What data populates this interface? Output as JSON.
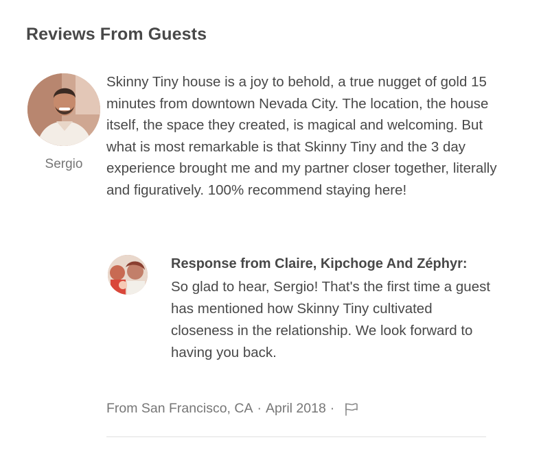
{
  "section": {
    "title": "Reviews From Guests"
  },
  "review": {
    "reviewer_name": "Sergio",
    "avatar_icon": "guest-avatar-photo",
    "text": "Skinny Tiny house is a joy to behold, a true nugget of gold 15 minutes from downtown Nevada City. The location, the house itself, the space they created, is magical and welcoming. But what is most remarkable is that Skinny Tiny and the 3 day experience brought me and my partner closer together, literally and figuratively. 100% recommend staying here!",
    "response": {
      "avatar_icon": "host-avatar-photo",
      "heading": "Response from Claire, Kipchoge And Zéphyr:",
      "text": "So glad to hear, Sergio! That's the first time a guest has mentioned how Skinny Tiny cultivated closeness in the relationship. We look forward to having you back."
    },
    "meta": {
      "location": "From San Francisco, CA",
      "separator": "·",
      "date": "April 2018",
      "separator2": "·",
      "flag_icon": "flag-icon"
    }
  },
  "colors": {
    "text_primary": "#484848",
    "text_secondary": "#767676",
    "divider": "#e0e0e0"
  }
}
